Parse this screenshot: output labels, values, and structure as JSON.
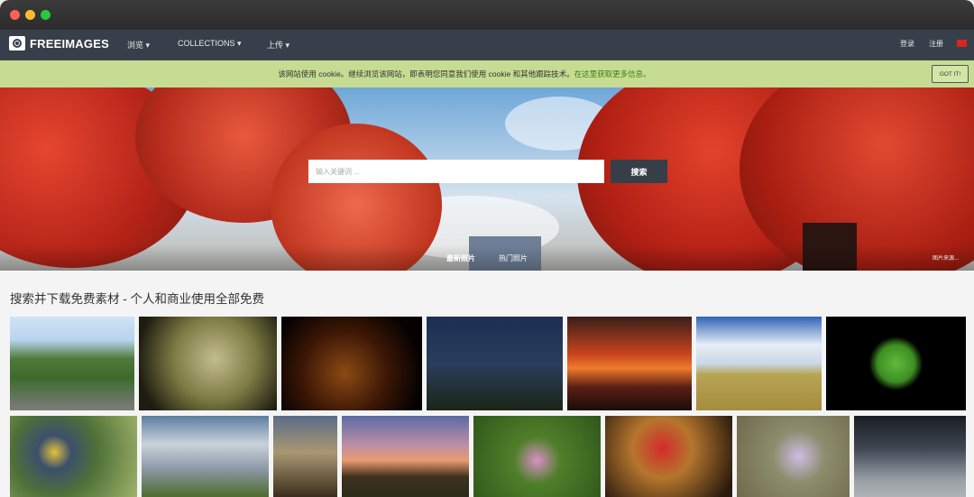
{
  "window": {
    "controls": [
      "close",
      "minimize",
      "zoom"
    ]
  },
  "navbar": {
    "brand": "FREEIMAGES",
    "menu": [
      {
        "label": "浏览 ▾"
      },
      {
        "label": "COLLECTIONS ▾"
      },
      {
        "label": "上传 ▾"
      }
    ],
    "login": "登录",
    "register": "注册",
    "language_flag": "cn-flag-icon"
  },
  "cookie_banner": {
    "text": "该网站使用 cookie。继续浏览该网站，即表明您同意我们使用 cookie 和其他跟踪技术。",
    "link": "在这里获取更多信息。",
    "button": "GOT IT!"
  },
  "hero": {
    "search_placeholder": "输入关键词 ...",
    "search_button": "搜索",
    "tabs": [
      {
        "label": "最新照片"
      },
      {
        "label": "热门照片"
      }
    ],
    "credit": "图片来源..."
  },
  "main": {
    "heading": "搜索并下载免费素材 - 个人和商业使用全部免费",
    "rows": [
      [
        "mountain-road",
        "dragonfly",
        "oil-lamp",
        "cemetery-night",
        "sunset-lake",
        "clouds-field",
        "green-leaf"
      ],
      [
        "bird-portrait",
        "stormy-clouds",
        "dramatic-sky",
        "sunset-rays",
        "pink-flower",
        "dog-santa-hat",
        "crocus-flowers",
        "subway-station"
      ]
    ]
  }
}
